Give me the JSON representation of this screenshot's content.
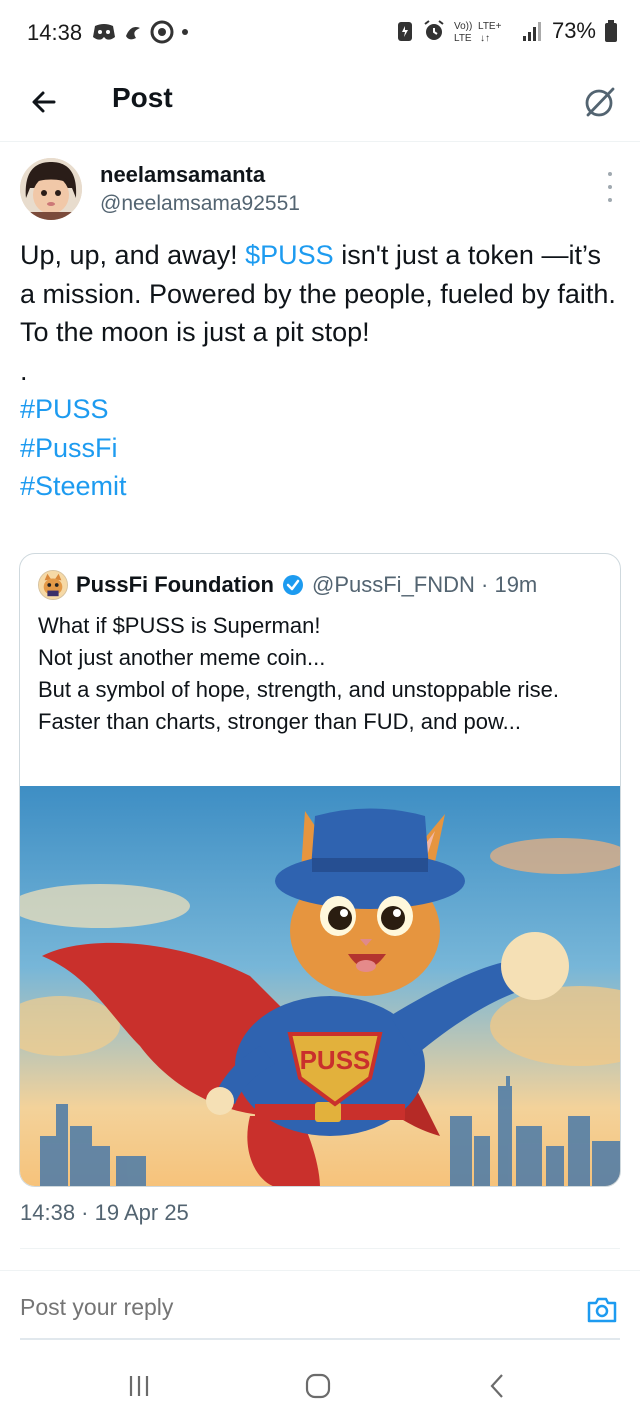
{
  "status_bar": {
    "time": "14:38",
    "battery": "73%",
    "network": "Vo)) LTE+"
  },
  "header": {
    "title": "Post",
    "back_icon": "arrow-left-icon",
    "grok_icon": "grok-icon"
  },
  "post": {
    "author_name": "neelamsamanta",
    "author_handle": "@neelamsama92551",
    "text_part1": "Up, up, and away! ",
    "cashtag": "$PUSS",
    "text_part2": " isn't just a token —it’s a mission. Powered by the people, fueled by faith. To the moon is just a pit stop!",
    "dot": ".",
    "hashtags": [
      "#PUSS",
      "#PussFi",
      "#Steemit"
    ],
    "timestamp": "14:38 · 19 Apr 25"
  },
  "quote": {
    "name": "PussFi Foundation",
    "handle_time": "@PussFi_FNDN · 19m",
    "verified": true,
    "lines": [
      "What if $PUSS is Superman!",
      "Not just another meme coin...",
      "But a symbol of hope, strength, and unstoppable rise.",
      "Faster than charts, stronger than FUD, and pow..."
    ],
    "image_chest_text": "PUSS"
  },
  "reply": {
    "placeholder": "Post your reply",
    "camera_icon": "camera-icon"
  },
  "colors": {
    "accent": "#1d9bf0",
    "text_primary": "#0f1419",
    "text_secondary": "#536471"
  }
}
